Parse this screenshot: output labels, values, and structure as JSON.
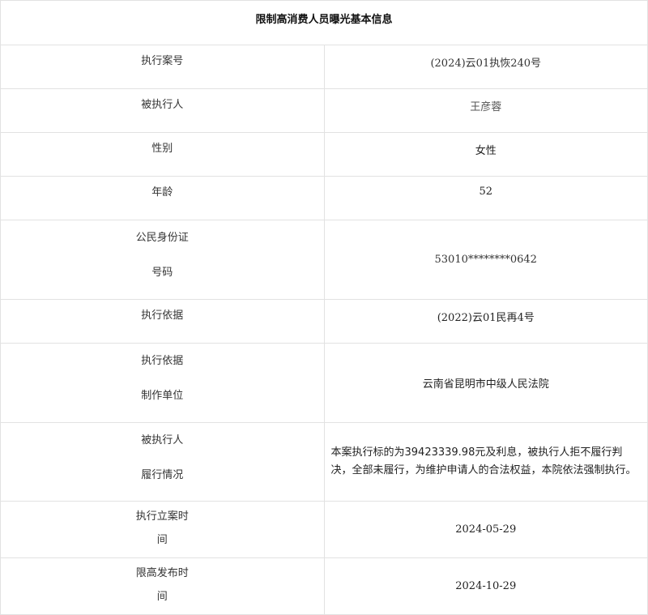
{
  "title": "限制高消费人员曝光基本信息",
  "rows": [
    {
      "label": "执行案号",
      "value": "(2024)云01执恢240号"
    },
    {
      "label": "被执行人",
      "value": "王彦蓉"
    },
    {
      "label": "性别",
      "value": "女性"
    },
    {
      "label": "年龄",
      "value": "52"
    },
    {
      "label": "公民身份证号码",
      "label_lines": [
        "公民身份证",
        "号码"
      ],
      "value": "53010********0642"
    },
    {
      "label": "执行依据",
      "value": "(2022)云01民再4号"
    },
    {
      "label": "执行依据制作单位",
      "label_lines": [
        "执行依据",
        "制作单位"
      ],
      "value": "云南省昆明市中级人民法院"
    },
    {
      "label": "被执行人履行情况",
      "label_lines": [
        "被执行人",
        "履行情况"
      ],
      "value": "本案执行标的为39423339.98元及利息，被执行人拒不履行判决，全部未履行，为维护申请人的合法权益，本院依法强制执行。"
    },
    {
      "label": "执行立案时间",
      "label_lines": [
        "执行立案时",
        "间"
      ],
      "value": "2024-05-29"
    },
    {
      "label": "限高发布时间",
      "label_lines": [
        "限高发布时",
        "间"
      ],
      "value": "2024-10-29"
    }
  ]
}
